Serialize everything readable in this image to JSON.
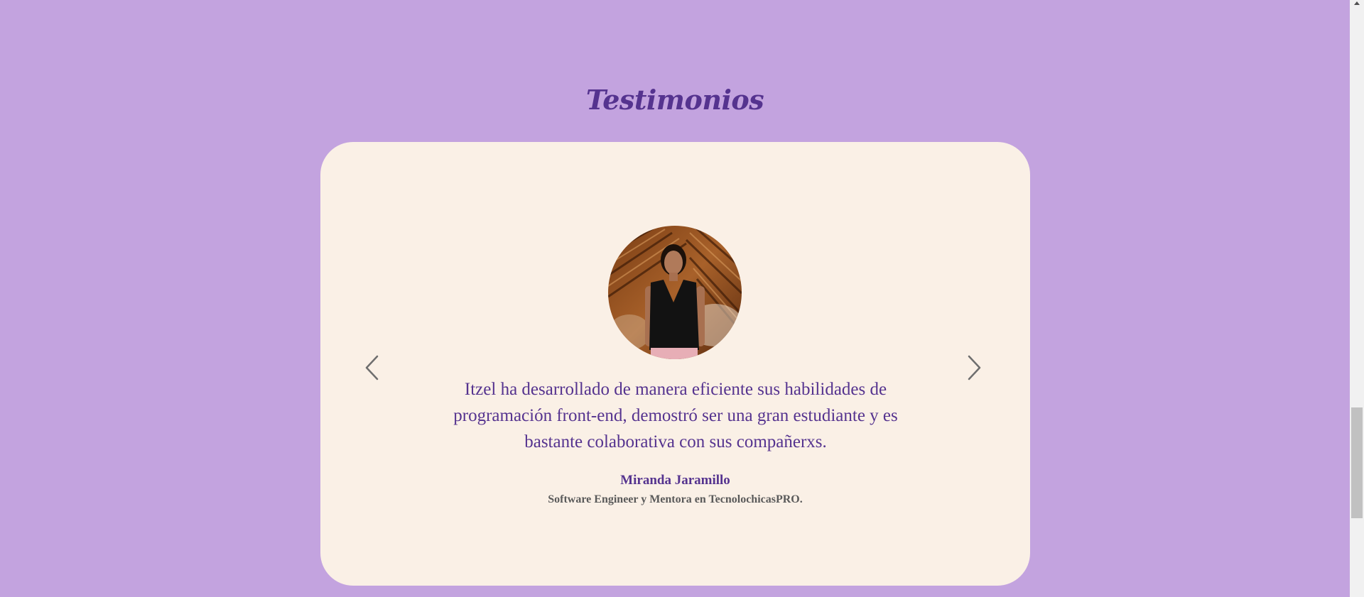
{
  "testimonials": {
    "title": "Testimonios",
    "quote": "Itzel ha desarrollado de manera eficiente sus habilidades de programación front-end, demostró ser una gran estudiante y es bastante colaborativa con sus compañerxs.",
    "author": "Miranda Jaramillo",
    "role": "Software Engineer y Mentora en TecnolochicasPRO.",
    "prev_icon": "chevron-left-icon",
    "next_icon": "chevron-right-icon",
    "photo": "person-photo"
  },
  "colors": {
    "background": "#c3a3df",
    "card": "#faf0e6",
    "accent": "#55338f",
    "secondary_text": "#5a5a5a"
  }
}
